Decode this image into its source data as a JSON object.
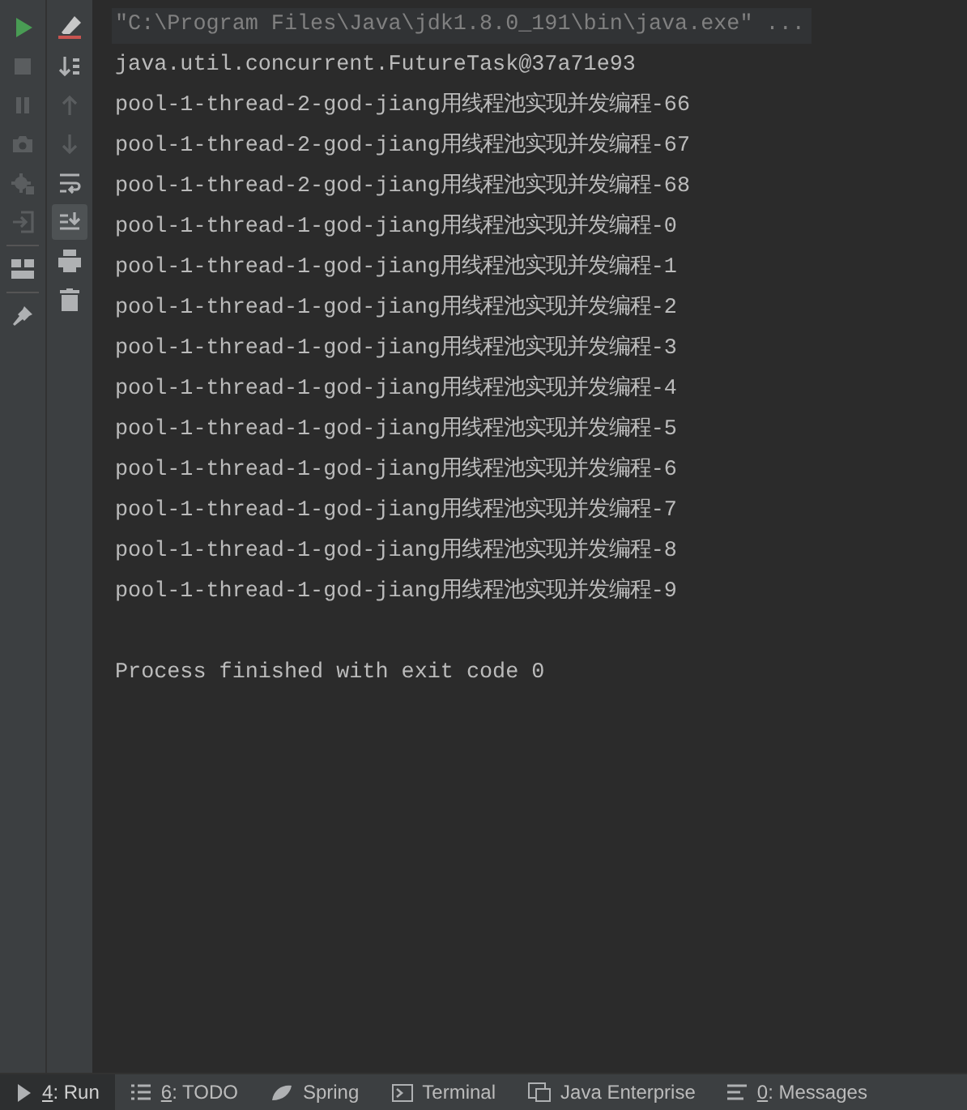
{
  "toolbar_left": [
    {
      "kind": "run",
      "disabled": false
    },
    {
      "kind": "stop",
      "disabled": true
    },
    {
      "kind": "pause",
      "disabled": true
    },
    {
      "kind": "camera",
      "disabled": true
    },
    {
      "kind": "bug",
      "disabled": true
    },
    {
      "kind": "enter",
      "disabled": true
    },
    {
      "kind": "separator"
    },
    {
      "kind": "layout",
      "disabled": false
    },
    {
      "kind": "separator"
    },
    {
      "kind": "pin",
      "disabled": false
    }
  ],
  "toolbar_right": [
    {
      "kind": "eraser",
      "disabled": false,
      "selected": false
    },
    {
      "kind": "sort-down",
      "disabled": false,
      "selected": false
    },
    {
      "kind": "arrow-up",
      "disabled": true,
      "selected": false
    },
    {
      "kind": "arrow-down",
      "disabled": true,
      "selected": false
    },
    {
      "kind": "wrap",
      "disabled": false,
      "selected": false
    },
    {
      "kind": "scroll-end",
      "disabled": false,
      "selected": true
    },
    {
      "kind": "print",
      "disabled": false,
      "selected": false
    },
    {
      "kind": "trash",
      "disabled": false,
      "selected": false
    }
  ],
  "console": [
    {
      "kind": "command",
      "text": "\"C:\\Program Files\\Java\\jdk1.8.0_191\\bin\\java.exe\" ..."
    },
    {
      "kind": "output",
      "text": "java.util.concurrent.FutureTask@37a71e93"
    },
    {
      "kind": "output",
      "text": "pool-1-thread-2-god-jiang用线程池实现并发编程-66"
    },
    {
      "kind": "output",
      "text": "pool-1-thread-2-god-jiang用线程池实现并发编程-67"
    },
    {
      "kind": "output",
      "text": "pool-1-thread-2-god-jiang用线程池实现并发编程-68"
    },
    {
      "kind": "output",
      "text": "pool-1-thread-1-god-jiang用线程池实现并发编程-0"
    },
    {
      "kind": "output",
      "text": "pool-1-thread-1-god-jiang用线程池实现并发编程-1"
    },
    {
      "kind": "output",
      "text": "pool-1-thread-1-god-jiang用线程池实现并发编程-2"
    },
    {
      "kind": "output",
      "text": "pool-1-thread-1-god-jiang用线程池实现并发编程-3"
    },
    {
      "kind": "output",
      "text": "pool-1-thread-1-god-jiang用线程池实现并发编程-4"
    },
    {
      "kind": "output",
      "text": "pool-1-thread-1-god-jiang用线程池实现并发编程-5"
    },
    {
      "kind": "output",
      "text": "pool-1-thread-1-god-jiang用线程池实现并发编程-6"
    },
    {
      "kind": "output",
      "text": "pool-1-thread-1-god-jiang用线程池实现并发编程-7"
    },
    {
      "kind": "output",
      "text": "pool-1-thread-1-god-jiang用线程池实现并发编程-8"
    },
    {
      "kind": "output",
      "text": "pool-1-thread-1-god-jiang用线程池实现并发编程-9"
    },
    {
      "kind": "status",
      "text": "Process finished with exit code 0"
    }
  ],
  "bottom_tabs": [
    {
      "kind": "play",
      "mnemonic": "4",
      "label": ": Run",
      "selected": true
    },
    {
      "kind": "list",
      "mnemonic": "6",
      "label": ": TODO",
      "selected": false
    },
    {
      "kind": "leaf",
      "label": "Spring",
      "selected": false
    },
    {
      "kind": "terminal",
      "label": "Terminal",
      "selected": false
    },
    {
      "kind": "box",
      "label": "Java Enterprise",
      "selected": false
    },
    {
      "kind": "lines",
      "mnemonic": "0",
      "label": ": Messages",
      "selected": false
    }
  ]
}
